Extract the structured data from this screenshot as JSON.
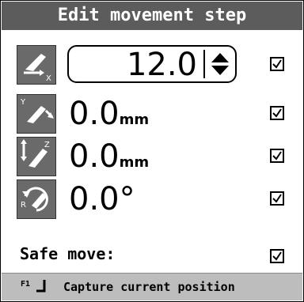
{
  "dialog": {
    "title": "Edit movement step"
  },
  "rows": [
    {
      "icon": "move-x-icon",
      "axis_letter": "X",
      "value": "12.0",
      "unit": "",
      "editable": true,
      "checked": true
    },
    {
      "icon": "move-y-icon",
      "axis_letter": "Y",
      "value": "0.0",
      "unit": "mm",
      "editable": false,
      "checked": true
    },
    {
      "icon": "move-z-icon",
      "axis_letter": "Z",
      "value": "0.0",
      "unit": "mm",
      "editable": false,
      "checked": true
    },
    {
      "icon": "rotate-r-icon",
      "axis_letter": "R",
      "value": "0.0",
      "unit": "°",
      "editable": false,
      "checked": true
    }
  ],
  "safe_move": {
    "label": "Safe move:",
    "checked": true
  },
  "statusbar": {
    "key": "F1",
    "text": "Capture current position"
  },
  "colors": {
    "title_bg": "#5c5c5c",
    "icon_bg": "#6a6a6a",
    "status_bg": "#bdbdbd"
  }
}
